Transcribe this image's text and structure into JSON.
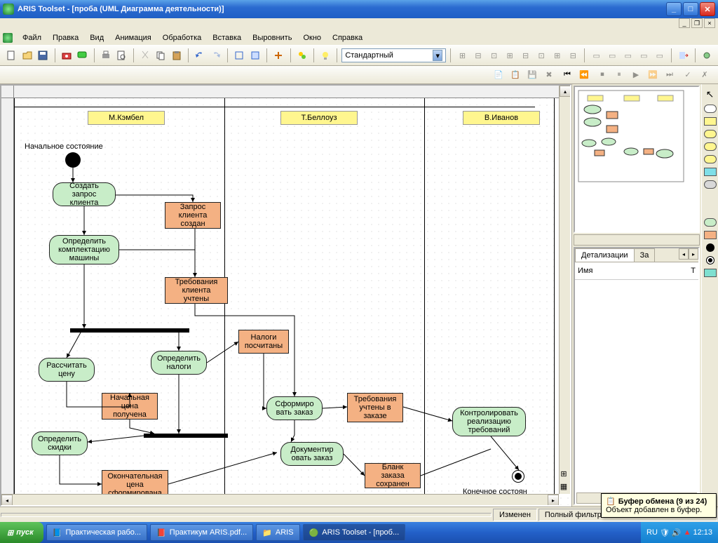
{
  "window": {
    "title": "ARIS Toolset - [проба (UML Диаграмма деятельности)]"
  },
  "menu": [
    "Файл",
    "Правка",
    "Вид",
    "Анимация",
    "Обработка",
    "Вставка",
    "Выровнить",
    "Окно",
    "Справка"
  ],
  "combo": {
    "value": "Стандартный"
  },
  "swimlanes": [
    "М.Кэмбел",
    "Т.Беллоуз",
    "В.Иванов"
  ],
  "labels": {
    "initial": "Начальное состояние",
    "final": "Конечное состоян"
  },
  "activities": {
    "a1": "Создать запрос клиента",
    "a2": "Определить комплектацию машины",
    "a3": "Рассчитать цену",
    "a4": "Определить налоги",
    "a5": "Определить скидки",
    "a6": "Сформиро вать заказ",
    "a7": "Документир овать заказ",
    "a8": "Контролировать реализацию требований"
  },
  "objects": {
    "o1": "Запрос клиента создан",
    "o2": "Требования клиента учтены",
    "o3": "Начальная цена получена",
    "o4": "Налоги посчитаны",
    "o5": "Окончательная цена сформирована",
    "o6": "Требования учтены в заказе",
    "o7": "Бланк заказа сохранен"
  },
  "side": {
    "tab1": "Детализации",
    "tab2": "За",
    "col1": "Имя",
    "col2": "Т"
  },
  "status": {
    "changed": "Изменен",
    "filter": "Полный фильтр"
  },
  "balloon": {
    "title": "Буфер обмена (9 из 24)",
    "body": "Объект добавлен в буфер."
  },
  "taskbar": {
    "start": "пуск",
    "tasks": [
      "Практическая рабо...",
      "Практикум ARIS.pdf...",
      "ARIS",
      "ARIS Toolset - [проб..."
    ],
    "lang": "RU",
    "clock": "12:13"
  }
}
